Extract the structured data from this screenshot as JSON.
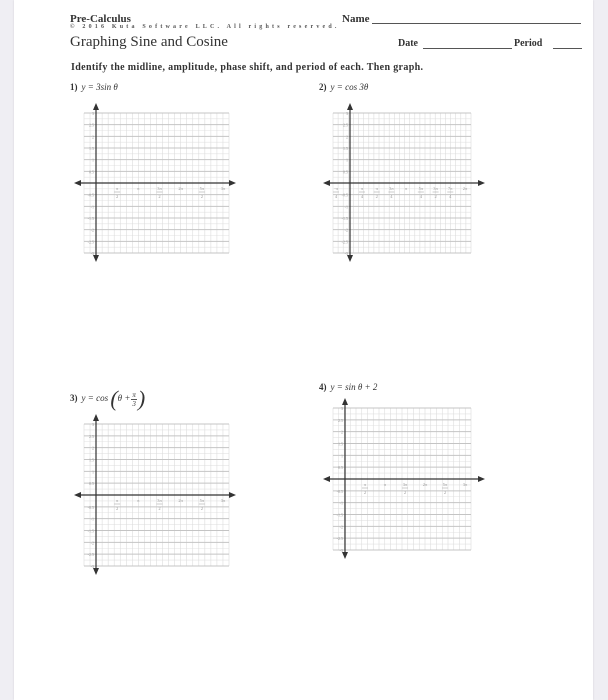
{
  "header": {
    "course": "Pre-Calculus",
    "copyright": "© 2016 Kuta Software LLC. All rights reserved.",
    "title": "Graphing Sine and Cosine",
    "name_label": "Name",
    "date_label": "Date",
    "period_label": "Period"
  },
  "instructions": "Identify the midline, amplitude, phase shift, and period of each. Then graph.",
  "problems": [
    {
      "number": "1)",
      "equation": "y = 3sin θ",
      "graph": {
        "x_ticks": [
          {
            "num": "π",
            "den": "2"
          },
          {
            "num": "π",
            "den": ""
          },
          {
            "num": "3π",
            "den": "2"
          },
          {
            "num": "2π",
            "den": ""
          },
          {
            "num": "5π",
            "den": "2"
          },
          {
            "num": "3π",
            "den": ""
          }
        ],
        "y_ticks": [
          "3",
          "2.5",
          "2",
          "1.5",
          "1",
          "0.5",
          "-0.5",
          "-1",
          "-1.5",
          "-2",
          "-2.5",
          "-3"
        ]
      }
    },
    {
      "number": "2)",
      "equation": "y = cos 3θ",
      "graph": {
        "x_ticks": [
          {
            "num": "-π",
            "den": "4"
          },
          {
            "num": "π",
            "den": "4"
          },
          {
            "num": "π",
            "den": "2"
          },
          {
            "num": "3π",
            "den": "4"
          },
          {
            "num": "π",
            "den": ""
          },
          {
            "num": "5π",
            "den": "4"
          },
          {
            "num": "3π",
            "den": "2"
          },
          {
            "num": "7π",
            "den": "4"
          },
          {
            "num": "2π",
            "den": ""
          }
        ],
        "y_ticks": [
          "3",
          "2.5",
          "2",
          "1.5",
          "1",
          "0.5",
          "-0.5",
          "-1",
          "-1.5",
          "-2",
          "-2.5",
          "-3"
        ]
      }
    },
    {
      "number": "3)",
      "equation_prefix": "y = cos",
      "equation_inner": "θ +",
      "equation_frac_num": "π",
      "equation_frac_den": "3",
      "graph": {
        "x_ticks": [
          {
            "num": "π",
            "den": "2"
          },
          {
            "num": "π",
            "den": ""
          },
          {
            "num": "3π",
            "den": "2"
          },
          {
            "num": "2π",
            "den": ""
          },
          {
            "num": "5π",
            "den": "2"
          },
          {
            "num": "3π",
            "den": ""
          }
        ],
        "y_ticks": [
          "3",
          "2.5",
          "2",
          "1.5",
          "1",
          "0.5",
          "-0.5",
          "-1",
          "-1.5",
          "-2",
          "-2.5",
          "-3"
        ]
      }
    },
    {
      "number": "4)",
      "equation": "y = sin θ + 2",
      "graph": {
        "x_ticks": [
          {
            "num": "π",
            "den": "2"
          },
          {
            "num": "π",
            "den": ""
          },
          {
            "num": "3π",
            "den": "2"
          },
          {
            "num": "2π",
            "den": ""
          },
          {
            "num": "5π",
            "den": "2"
          },
          {
            "num": "3π",
            "den": ""
          }
        ],
        "y_ticks": [
          "3",
          "2.5",
          "2",
          "1.5",
          "1",
          "0.5",
          "-0.5",
          "-1",
          "-1.5",
          "-2",
          "-2.5",
          "-3"
        ]
      }
    }
  ]
}
